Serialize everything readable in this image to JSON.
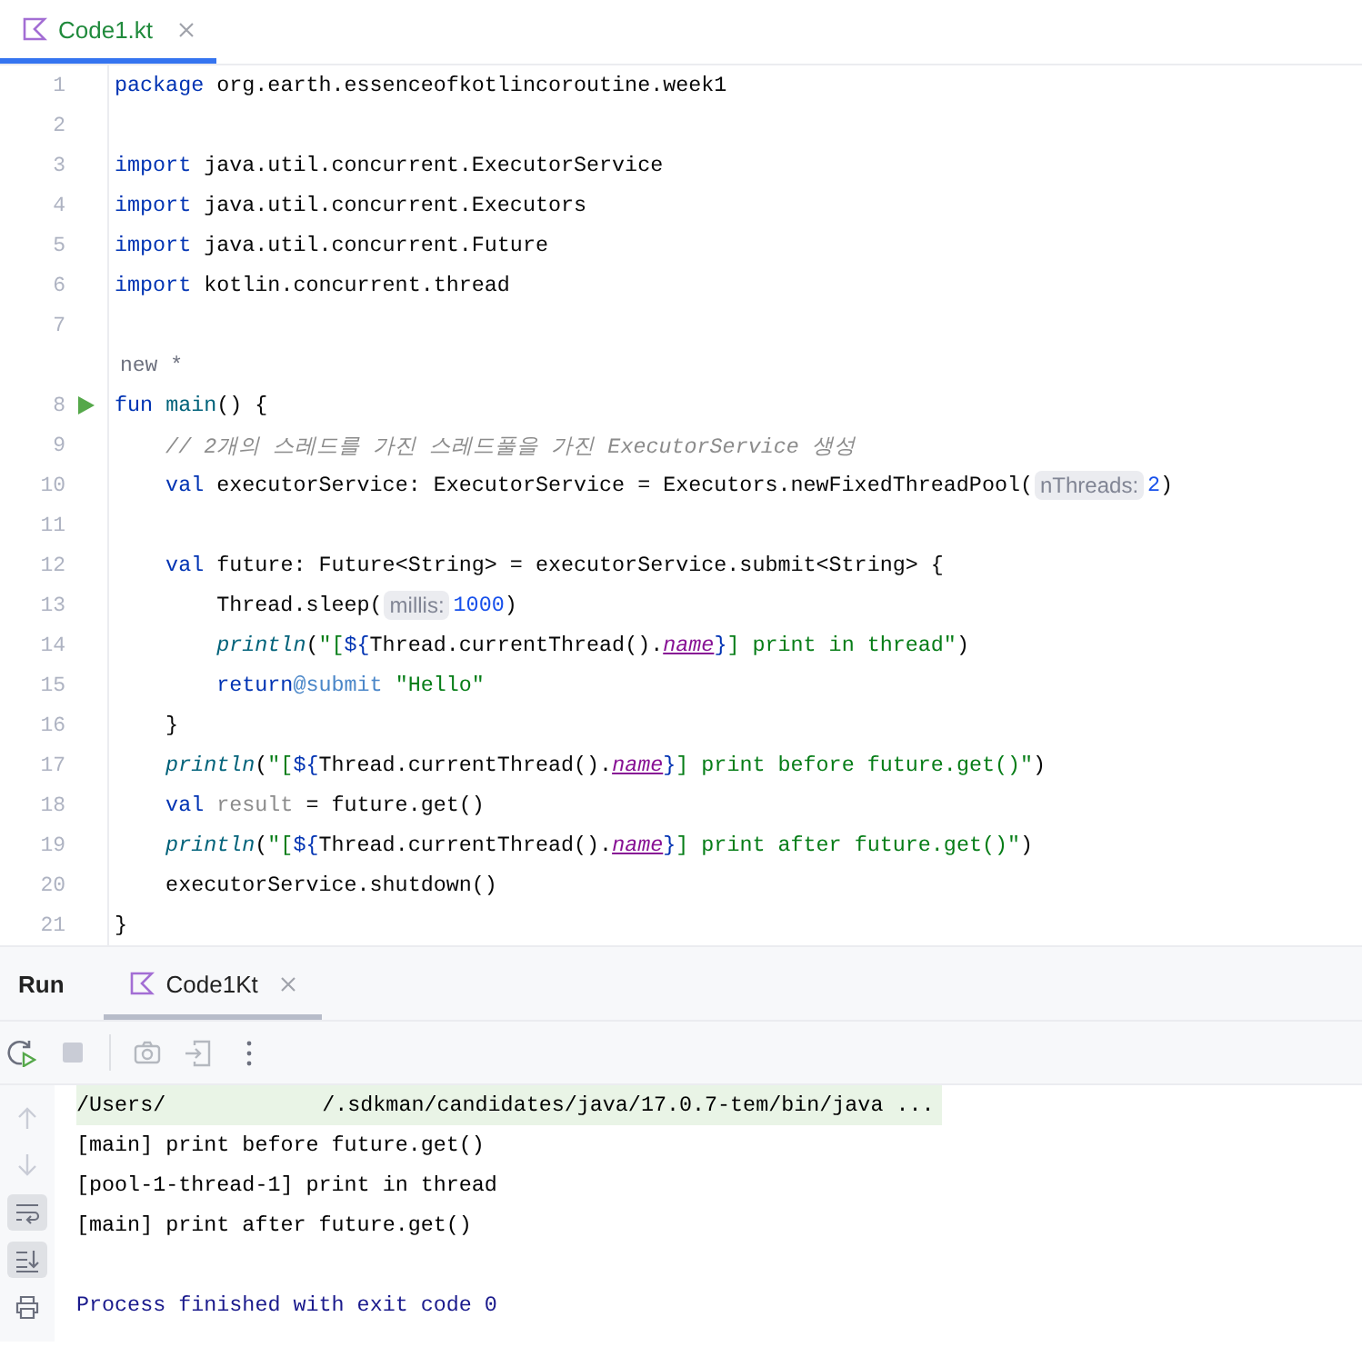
{
  "editor_tabs": [
    {
      "label": "Code1.kt",
      "selected": true
    }
  ],
  "editor": {
    "lines": [
      {
        "kind": "code",
        "number": "1",
        "tokens": [
          {
            "kind": "keyword",
            "text": "package"
          },
          {
            "kind": "plain",
            "text": " org.earth.essenceofkotlincoroutine.week1"
          }
        ]
      },
      {
        "kind": "code",
        "number": "2"
      },
      {
        "kind": "code",
        "number": "3",
        "tokens": [
          {
            "kind": "keyword",
            "text": "import"
          },
          {
            "kind": "plain",
            "text": " java.util.concurrent.ExecutorService"
          }
        ]
      },
      {
        "kind": "code",
        "number": "4",
        "tokens": [
          {
            "kind": "keyword",
            "text": "import"
          },
          {
            "kind": "plain",
            "text": " java.util.concurrent.Executors"
          }
        ]
      },
      {
        "kind": "code",
        "number": "5",
        "tokens": [
          {
            "kind": "keyword",
            "text": "import"
          },
          {
            "kind": "plain",
            "text": " java.util.concurrent.Future"
          }
        ]
      },
      {
        "kind": "code",
        "number": "6",
        "tokens": [
          {
            "kind": "keyword",
            "text": "import"
          },
          {
            "kind": "plain",
            "text": " kotlin.concurrent.thread"
          }
        ]
      },
      {
        "kind": "code",
        "number": "7"
      },
      {
        "kind": "annotation",
        "text": "new *"
      },
      {
        "kind": "code",
        "number": "8",
        "runnable": true,
        "tokens": [
          {
            "kind": "keyword",
            "text": "fun "
          },
          {
            "kind": "declaration",
            "text": "main"
          },
          {
            "kind": "plain",
            "text": "() {"
          }
        ]
      },
      {
        "kind": "code",
        "number": "9",
        "tokens": [
          {
            "kind": "comment",
            "text": "    // 2개의 스레드를 가진 스레드풀을 가진 ExecutorService 생성"
          }
        ]
      },
      {
        "kind": "code",
        "number": "10",
        "tokens": [
          {
            "kind": "keyword",
            "text": "    val"
          },
          {
            "kind": "plain",
            "text": " executorService: ExecutorService = Executors.newFixedThreadPool("
          },
          {
            "kind": "hint",
            "text": "nThreads:"
          },
          {
            "kind": "number",
            "text": "2"
          },
          {
            "kind": "plain",
            "text": ")"
          }
        ]
      },
      {
        "kind": "code",
        "number": "11"
      },
      {
        "kind": "code",
        "number": "12",
        "tokens": [
          {
            "kind": "keyword",
            "text": "    val"
          },
          {
            "kind": "plain",
            "text": " future: Future<String> = executorService.submit<String> {"
          }
        ]
      },
      {
        "kind": "code",
        "number": "13",
        "tokens": [
          {
            "kind": "plain",
            "text": "        Thread.sleep("
          },
          {
            "kind": "hint",
            "text": "millis:"
          },
          {
            "kind": "number",
            "text": "1000"
          },
          {
            "kind": "plain",
            "text": ")"
          }
        ]
      },
      {
        "kind": "code",
        "number": "14",
        "tokens": [
          {
            "kind": "call",
            "text": "        println"
          },
          {
            "kind": "plain",
            "text": "("
          },
          {
            "kind": "string",
            "text": "\"["
          },
          {
            "kind": "keyword",
            "text": "${"
          },
          {
            "kind": "plain",
            "text": "Thread.currentThread()."
          },
          {
            "kind": "property",
            "text": "name"
          },
          {
            "kind": "keyword",
            "text": "}"
          },
          {
            "kind": "string",
            "text": "] print in thread\""
          },
          {
            "kind": "plain",
            "text": ")"
          }
        ]
      },
      {
        "kind": "code",
        "number": "15",
        "tokens": [
          {
            "kind": "keyword",
            "text": "        return"
          },
          {
            "kind": "label",
            "text": "@submit"
          },
          {
            "kind": "string",
            "text": " \"Hello\""
          }
        ]
      },
      {
        "kind": "code",
        "number": "16",
        "tokens": [
          {
            "kind": "plain",
            "text": "    }"
          }
        ]
      },
      {
        "kind": "code",
        "number": "17",
        "tokens": [
          {
            "kind": "call",
            "text": "    println"
          },
          {
            "kind": "plain",
            "text": "("
          },
          {
            "kind": "string",
            "text": "\"["
          },
          {
            "kind": "keyword",
            "text": "${"
          },
          {
            "kind": "plain",
            "text": "Thread.currentThread()."
          },
          {
            "kind": "property",
            "text": "name"
          },
          {
            "kind": "keyword",
            "text": "}"
          },
          {
            "kind": "string",
            "text": "] print before future.get()\""
          },
          {
            "kind": "plain",
            "text": ")"
          }
        ]
      },
      {
        "kind": "code",
        "number": "18",
        "tokens": [
          {
            "kind": "keyword",
            "text": "    val "
          },
          {
            "kind": "unused",
            "text": "result"
          },
          {
            "kind": "plain",
            "text": " = future.get()"
          }
        ]
      },
      {
        "kind": "code",
        "number": "19",
        "tokens": [
          {
            "kind": "call",
            "text": "    println"
          },
          {
            "kind": "plain",
            "text": "("
          },
          {
            "kind": "string",
            "text": "\"["
          },
          {
            "kind": "keyword",
            "text": "${"
          },
          {
            "kind": "plain",
            "text": "Thread.currentThread()."
          },
          {
            "kind": "property",
            "text": "name"
          },
          {
            "kind": "keyword",
            "text": "}"
          },
          {
            "kind": "string",
            "text": "] print after future.get()\""
          },
          {
            "kind": "plain",
            "text": ")"
          }
        ]
      },
      {
        "kind": "code",
        "number": "20",
        "tokens": [
          {
            "kind": "plain",
            "text": "    executorService.shutdown()"
          }
        ]
      },
      {
        "kind": "code",
        "number": "21",
        "tokens": [
          {
            "kind": "plain",
            "text": "}"
          }
        ]
      }
    ]
  },
  "run_panel": {
    "title": "Run",
    "tabs": [
      {
        "label": "Code1Kt",
        "selected": true
      }
    ],
    "toolbar": [
      {
        "kind": "rerun"
      },
      {
        "kind": "stop"
      },
      {
        "kind": "separator"
      },
      {
        "kind": "camera"
      },
      {
        "kind": "exit"
      },
      {
        "kind": "more"
      }
    ],
    "side_tools": [
      {
        "kind": "up",
        "selected": false
      },
      {
        "kind": "down",
        "selected": false
      },
      {
        "kind": "wrap",
        "selected": true
      },
      {
        "kind": "scroll",
        "selected": true
      },
      {
        "kind": "print",
        "selected": false
      }
    ],
    "console": [
      {
        "kind": "command",
        "before": "/Users/",
        "after": "/.sdkman/candidates/java/17.0.7-tem/bin/java ..."
      },
      {
        "kind": "output",
        "text": "[main] print before future.get()"
      },
      {
        "kind": "output",
        "text": "[pool-1-thread-1] print in thread"
      },
      {
        "kind": "output",
        "text": "[main] print after future.get()"
      },
      {
        "kind": "exit",
        "text": "Process finished with exit code 0"
      }
    ]
  }
}
